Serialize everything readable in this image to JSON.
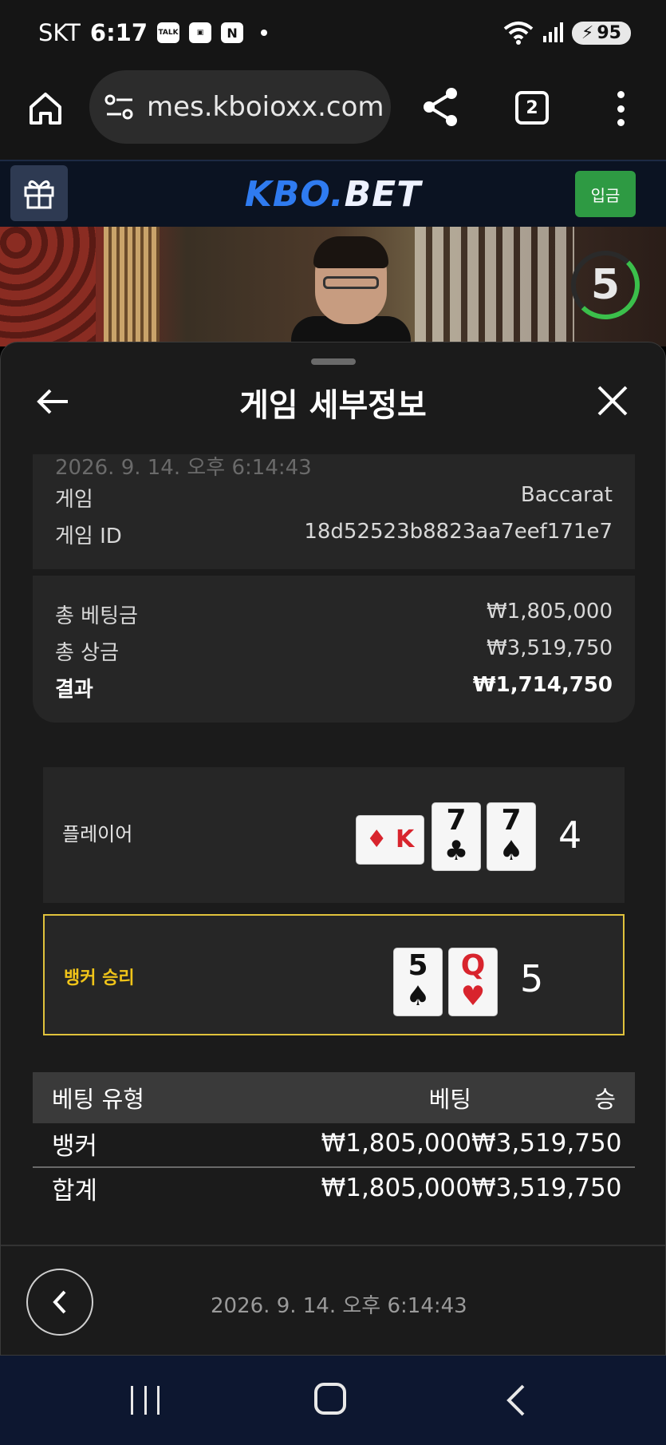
{
  "status_bar": {
    "carrier": "SKT",
    "time": "6:17",
    "talk_icon_text": "TALK",
    "n_icon_text": "N",
    "battery": "95"
  },
  "browser": {
    "url": "mes.kboioxx.com",
    "tab_count": "2"
  },
  "site": {
    "logo_kbo": "KBO.",
    "logo_bet": "BET",
    "deposit_label": "입금"
  },
  "video": {
    "timer": "5",
    "timer_color": "#3bbf4b"
  },
  "sheet": {
    "title": "게임 세부정보",
    "faded_timestamp": "2026. 9. 14. 오후 6:14:43",
    "game_label": "게임",
    "game_value": "Baccarat",
    "game_id_label": "게임 ID",
    "game_id_value": "18d52523b8823aa7eef171e7",
    "total_bet_label": "총 베팅금",
    "total_bet_value": "₩1,805,000",
    "total_prize_label": "총 상금",
    "total_prize_value": "₩3,519,750",
    "result_label": "결과",
    "result_value": "₩1,714,750"
  },
  "hands": {
    "player": {
      "label": "플레이어",
      "score": "4",
      "cards": [
        {
          "rank": "K",
          "suit": "♦",
          "color": "red"
        },
        {
          "rank": "7",
          "suit": "♣",
          "color": "black"
        },
        {
          "rank": "7",
          "suit": "♠",
          "color": "black"
        }
      ]
    },
    "banker": {
      "label": "뱅커 승리",
      "score": "5",
      "highlight_color": "#e0c23c",
      "cards": [
        {
          "rank": "5",
          "suit": "♠",
          "color": "black"
        },
        {
          "rank": "Q",
          "suit": "♥",
          "color": "red"
        }
      ]
    }
  },
  "bet_table": {
    "headers": [
      "베팅 유형",
      "베팅",
      "승"
    ],
    "rows": [
      [
        "뱅커",
        "₩1,805,000",
        "₩3,519,750"
      ],
      [
        "합계",
        "₩1,805,000",
        "₩3,519,750"
      ]
    ]
  },
  "footer": {
    "date": "2026. 9. 14. 오후 6:14:43"
  }
}
